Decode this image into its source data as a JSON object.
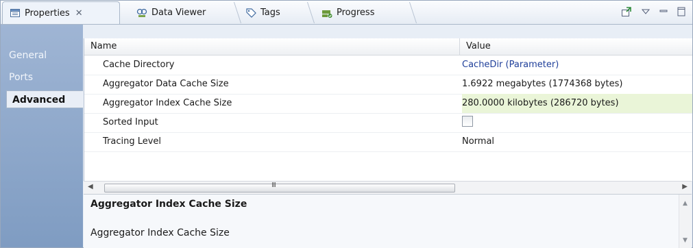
{
  "tabs": [
    {
      "label": "Properties",
      "icon": "properties-icon",
      "active": true,
      "close": "✕"
    },
    {
      "label": "Data Viewer",
      "icon": "data-viewer-icon",
      "active": false
    },
    {
      "label": "Tags",
      "icon": "tag-icon",
      "active": false
    },
    {
      "label": "Progress",
      "icon": "progress-icon",
      "active": false
    }
  ],
  "view_tools": [
    "pin-editor-icon",
    "view-menu-icon",
    "minimize-icon",
    "maximize-icon"
  ],
  "nav": [
    {
      "label": "General",
      "selected": false
    },
    {
      "label": "Ports",
      "selected": false
    },
    {
      "label": "Advanced",
      "selected": true
    }
  ],
  "table": {
    "columns": [
      "Name",
      "Value"
    ],
    "rows": [
      {
        "name": "Cache Directory",
        "value": "CacheDir (Parameter)",
        "kind": "parameter"
      },
      {
        "name": "Aggregator Data Cache Size",
        "value": "1.6922 megabytes  (1774368 bytes)",
        "kind": "text"
      },
      {
        "name": "Aggregator Index Cache Size",
        "value": "280.0000 kilobytes  (286720 bytes)",
        "kind": "text",
        "selected": true
      },
      {
        "name": "Sorted Input",
        "value": "",
        "kind": "checkbox",
        "checked": false
      },
      {
        "name": "Tracing Level",
        "value": "Normal",
        "kind": "text"
      }
    ]
  },
  "scrollbar": {
    "grip": "III"
  },
  "description": {
    "title": "Aggregator Index Cache Size",
    "text": "Aggregator Index Cache Size"
  },
  "colors": {
    "nav_bg": "#8fa9cc",
    "selected_value_bg": "#eaf5d8",
    "parameter_text": "#1f3f9a"
  }
}
